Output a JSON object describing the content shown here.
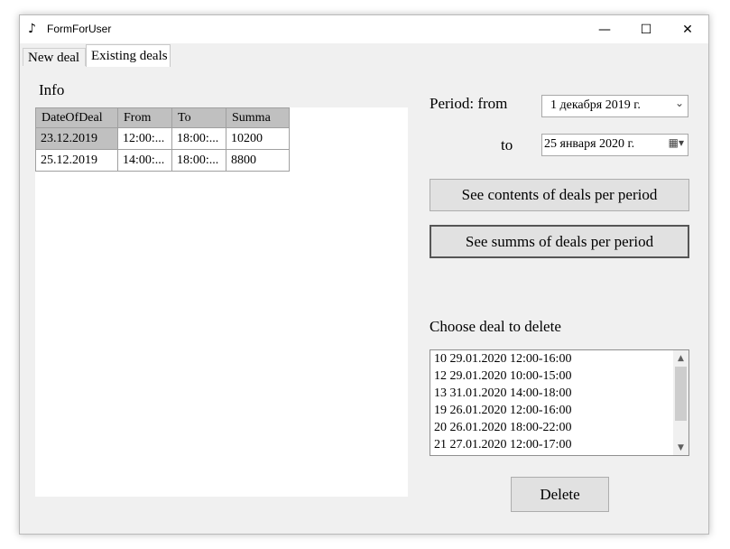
{
  "window": {
    "title": "FormForUser",
    "minimize": "—",
    "maximize": "☐",
    "close": "✕"
  },
  "tabs": [
    {
      "label": "New deal"
    },
    {
      "label": "Existing deals"
    }
  ],
  "info": {
    "label": "Info",
    "columns": [
      "DateOfDeal",
      "From",
      "To",
      "Summa"
    ],
    "rows": [
      [
        "23.12.2019",
        "12:00:...",
        "18:00:...",
        "10200"
      ],
      [
        "25.12.2019",
        "14:00:...",
        "18:00:...",
        "8800"
      ]
    ]
  },
  "period": {
    "from_label": "Period: from",
    "to_label": "to",
    "from_value": "1  декабря  2019 г.",
    "to_value": "25  января   2020 г."
  },
  "buttons": {
    "contents": "See contents of deals per period",
    "summs": "See summs of deals per period",
    "delete": "Delete"
  },
  "delete_section": {
    "label": "Choose deal to delete",
    "items": [
      "10 29.01.2020 12:00-16:00",
      "12 29.01.2020 10:00-15:00",
      "13 31.01.2020 14:00-18:00",
      "19 26.01.2020 12:00-16:00",
      "20 26.01.2020 18:00-22:00",
      "21 27.01.2020 12:00-17:00"
    ]
  }
}
